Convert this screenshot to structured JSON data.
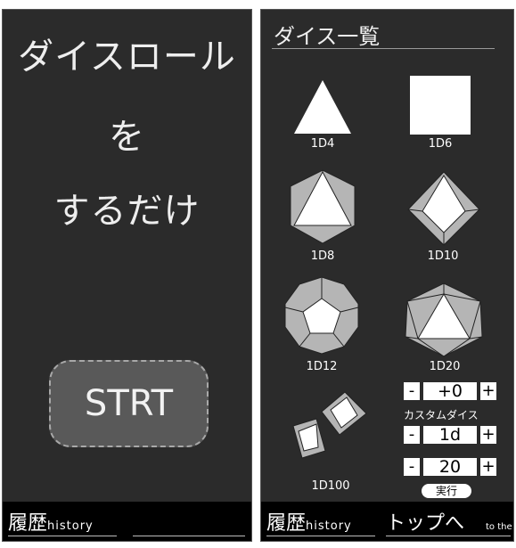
{
  "left_panel": {
    "hero_lines": [
      "ダイスロール",
      "を",
      "するだけ"
    ],
    "start_label": "STRT"
  },
  "footer": {
    "history_main": "履歴",
    "history_sub": "history",
    "top_main": "トップへ",
    "top_sub": "to the top"
  },
  "dice_list": {
    "title": "ダイス一覧",
    "dice": [
      {
        "label": "1D4",
        "icon": "tetrahedron-icon"
      },
      {
        "label": "1D6",
        "icon": "cube-icon"
      },
      {
        "label": "1D8",
        "icon": "octahedron-icon"
      },
      {
        "label": "1D10",
        "icon": "decahedron-icon"
      },
      {
        "label": "1D12",
        "icon": "dodecahedron-icon"
      },
      {
        "label": "1D20",
        "icon": "icosahedron-icon"
      },
      {
        "label": "1D100",
        "icon": "two-dice-icon"
      }
    ],
    "custom": {
      "label": "カスタムダイス",
      "modifier": "+0",
      "dice_count": "1d",
      "sides": "20",
      "minus": "-",
      "plus": "+",
      "run_label": "実行"
    }
  },
  "colors": {
    "panel_bg": "#2b2b2b",
    "footer_bg": "#000000",
    "die_fill": "#ffffff",
    "die_shade": "#b5b5b5"
  }
}
